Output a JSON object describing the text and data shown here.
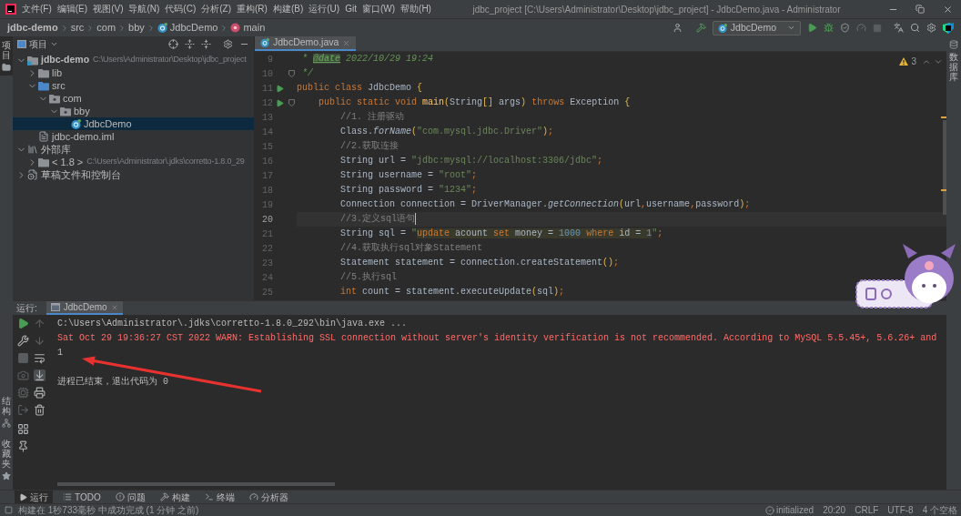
{
  "window": {
    "title": "jdbc_project [C:\\Users\\Administrator\\Desktop\\jdbc_project] - JdbcDemo.java - Administrator"
  },
  "menu": [
    "文件(F)",
    "编辑(E)",
    "视图(V)",
    "导航(N)",
    "代码(C)",
    "分析(Z)",
    "重构(R)",
    "构建(B)",
    "运行(U)",
    "Git",
    "窗口(W)",
    "帮助(H)"
  ],
  "breadcrumb": [
    {
      "label": "jdbc-demo",
      "kind": "project"
    },
    {
      "label": "src",
      "kind": "folder"
    },
    {
      "label": "com",
      "kind": "folder"
    },
    {
      "label": "bby",
      "kind": "folder"
    },
    {
      "label": "JdbcDemo",
      "kind": "class"
    },
    {
      "label": "main",
      "kind": "method"
    }
  ],
  "toolbar": {
    "run_config": "JdbcDemo"
  },
  "left_strip": {
    "top": [
      {
        "label": "项目",
        "kind": "project",
        "selected": true
      }
    ],
    "bottom": [
      {
        "label": "结构",
        "kind": "structure",
        "selected": false
      },
      {
        "label": "收藏夹",
        "kind": "favorites",
        "selected": false
      }
    ]
  },
  "right_strip": [
    {
      "label": "数据库",
      "kind": "database",
      "selected": false
    }
  ],
  "project_panel": {
    "title": "项目",
    "tree": [
      {
        "label": "jdbc-demo",
        "kind": "module",
        "hint": "C:\\Users\\Administrator\\Desktop\\jdbc_project",
        "expanded": true,
        "selected": false,
        "children": [
          {
            "label": "lib",
            "kind": "folder",
            "expanded": false,
            "selected": false
          },
          {
            "label": "src",
            "kind": "source",
            "expanded": true,
            "selected": false,
            "children": [
              {
                "label": "com",
                "kind": "package",
                "expanded": true,
                "selected": false,
                "children": [
                  {
                    "label": "bby",
                    "kind": "package",
                    "expanded": true,
                    "selected": false,
                    "children": [
                      {
                        "label": "JdbcDemo",
                        "kind": "class",
                        "selected": true
                      }
                    ]
                  }
                ]
              }
            ]
          },
          {
            "label": "jdbc-demo.iml",
            "kind": "file",
            "selected": false
          }
        ]
      },
      {
        "label": "外部库",
        "kind": "library",
        "expanded": true,
        "selected": false,
        "children": [
          {
            "label": "< 1.8 >",
            "kind": "sdk",
            "hint": "C:\\Users\\Administrator\\.jdks\\corretto-1.8.0_29",
            "expanded": false,
            "selected": false
          }
        ]
      },
      {
        "label": "草稿文件和控制台",
        "kind": "scratch",
        "expanded": false,
        "selected": false
      }
    ]
  },
  "editor": {
    "tabs": [
      {
        "label": "JdbcDemo.java",
        "selected": true
      }
    ],
    "warning_count": "3",
    "lines": [
      {
        "number": "9",
        "current": false,
        "tokens": [
          {
            "kind": "doc",
            "text": " * "
          },
          {
            "kind": "doctag",
            "text": "@date"
          },
          {
            "kind": "doc",
            "text": " 2022/10/29 19:24"
          }
        ]
      },
      {
        "number": "10",
        "current": false,
        "markers": [
          {
            "kind": "fold"
          }
        ],
        "tokens": [
          {
            "kind": "doc",
            "text": " */"
          }
        ]
      },
      {
        "number": "11",
        "current": false,
        "markers": [
          {
            "kind": "run"
          }
        ],
        "tokens": [
          {
            "kind": "keyword",
            "text": "public class "
          },
          {
            "kind": "plain",
            "text": "JdbcDemo "
          },
          {
            "kind": "brace",
            "text": "{"
          }
        ]
      },
      {
        "number": "12",
        "current": false,
        "markers": [
          {
            "kind": "run"
          },
          {
            "kind": "fold"
          }
        ],
        "tokens": [
          {
            "kind": "keyword",
            "text": "    public static void "
          },
          {
            "kind": "decl",
            "text": "main"
          },
          {
            "kind": "brace",
            "text": "("
          },
          {
            "kind": "plain",
            "text": "String"
          },
          {
            "kind": "brace",
            "text": "[]"
          },
          {
            "kind": "plain",
            "text": " args"
          },
          {
            "kind": "brace",
            "text": ")"
          },
          {
            "kind": "keyword",
            "text": " throws "
          },
          {
            "kind": "plain",
            "text": "Exception "
          },
          {
            "kind": "brace",
            "text": "{"
          }
        ]
      },
      {
        "number": "13",
        "current": false,
        "tokens": [
          {
            "kind": "comment",
            "text": "        //1. 注册驱动"
          }
        ]
      },
      {
        "number": "14",
        "current": false,
        "tokens": [
          {
            "kind": "plain",
            "text": "        Class."
          },
          {
            "kind": "method",
            "text": "forName"
          },
          {
            "kind": "brace",
            "text": "("
          },
          {
            "kind": "string",
            "text": "\"com.mysql.jdbc.Driver\""
          },
          {
            "kind": "brace",
            "text": ")"
          },
          {
            "kind": "keyword",
            "text": ";"
          }
        ]
      },
      {
        "number": "15",
        "current": false,
        "tokens": [
          {
            "kind": "comment",
            "text": "        //2.获取连接"
          }
        ]
      },
      {
        "number": "16",
        "current": false,
        "tokens": [
          {
            "kind": "plain",
            "text": "        String url = "
          },
          {
            "kind": "string",
            "text": "\"jdbc:mysql://localhost:3306/jdbc\""
          },
          {
            "kind": "keyword",
            "text": ";"
          }
        ]
      },
      {
        "number": "17",
        "current": false,
        "tokens": [
          {
            "kind": "plain",
            "text": "        String username = "
          },
          {
            "kind": "string",
            "text": "\"root\""
          },
          {
            "kind": "keyword",
            "text": ";"
          }
        ]
      },
      {
        "number": "18",
        "current": false,
        "tokens": [
          {
            "kind": "plain",
            "text": "        String password = "
          },
          {
            "kind": "string",
            "text": "\"1234\""
          },
          {
            "kind": "keyword",
            "text": ";"
          }
        ]
      },
      {
        "number": "19",
        "current": false,
        "tokens": [
          {
            "kind": "plain",
            "text": "        Connection connection = DriverManager."
          },
          {
            "kind": "method",
            "text": "getConnection"
          },
          {
            "kind": "brace",
            "text": "("
          },
          {
            "kind": "plain",
            "text": "url"
          },
          {
            "kind": "keyword",
            "text": ","
          },
          {
            "kind": "plain",
            "text": "username"
          },
          {
            "kind": "keyword",
            "text": ","
          },
          {
            "kind": "plain",
            "text": "password"
          },
          {
            "kind": "brace",
            "text": ")"
          },
          {
            "kind": "keyword",
            "text": ";"
          }
        ]
      },
      {
        "number": "20",
        "current": true,
        "tokens": [
          {
            "kind": "comment",
            "text": "        //3.定义sql语句"
          }
        ]
      },
      {
        "number": "21",
        "current": false,
        "tokens": [
          {
            "kind": "plain",
            "text": "        String sql = "
          },
          {
            "kind": "string",
            "text": "\""
          },
          {
            "kind": "sql_keyword",
            "text": "update"
          },
          {
            "kind": "sql_plain",
            "text": " acount "
          },
          {
            "kind": "sql_keyword",
            "text": "set"
          },
          {
            "kind": "sql_plain",
            "text": " money = "
          },
          {
            "kind": "sql_number",
            "text": "1000"
          },
          {
            "kind": "sql_keyword",
            "text": " where"
          },
          {
            "kind": "sql_plain",
            "text": " id = "
          },
          {
            "kind": "sql_number",
            "text": "1"
          },
          {
            "kind": "string",
            "text": "\""
          },
          {
            "kind": "keyword",
            "text": ";"
          }
        ]
      },
      {
        "number": "22",
        "current": false,
        "tokens": [
          {
            "kind": "comment",
            "text": "        //4.获取执行sql对象Statement"
          }
        ]
      },
      {
        "number": "23",
        "current": false,
        "tokens": [
          {
            "kind": "plain",
            "text": "        Statement statement = connection.createStatement"
          },
          {
            "kind": "brace",
            "text": "()"
          },
          {
            "kind": "keyword",
            "text": ";"
          }
        ]
      },
      {
        "number": "24",
        "current": false,
        "tokens": [
          {
            "kind": "comment",
            "text": "        //5.执行sql"
          }
        ]
      },
      {
        "number": "25",
        "current": false,
        "tokens": [
          {
            "kind": "keyword",
            "text": "        int "
          },
          {
            "kind": "plain",
            "text": "count = statement.executeUpdate"
          },
          {
            "kind": "brace",
            "text": "("
          },
          {
            "kind": "plain",
            "text": "sql"
          },
          {
            "kind": "brace",
            "text": ")"
          },
          {
            "kind": "keyword",
            "text": ";"
          }
        ]
      }
    ]
  },
  "run_panel": {
    "label": "运行:",
    "tabs": [
      {
        "label": "JdbcDemo",
        "selected": true
      }
    ],
    "console": [
      {
        "kind": "command",
        "text": "C:\\Users\\Administrator\\.jdks\\corretto-1.8.0_292\\bin\\java.exe ..."
      },
      {
        "kind": "error",
        "text": "Sat Oct 29 19:36:27 CST 2022 WARN: Establishing SSL connection without server's identity verification is not recommended. According to MySQL 5.5.45+, 5.6.26+ and"
      },
      {
        "kind": "output",
        "text": "1"
      },
      {
        "kind": "exit",
        "text": "进程已结束，退出代码为 0"
      }
    ]
  },
  "tool_tabs": [
    {
      "label": "运行",
      "kind": "run",
      "selected": true
    },
    {
      "label": "TODO",
      "kind": "todo",
      "selected": false
    },
    {
      "label": "问题",
      "kind": "problems",
      "selected": false
    },
    {
      "label": "构建",
      "kind": "build",
      "selected": false
    },
    {
      "label": "终端",
      "kind": "terminal",
      "selected": false
    },
    {
      "label": "分析器",
      "kind": "profiler",
      "selected": false
    }
  ],
  "status_bar": {
    "message": "构建在 1秒733毫秒 中成功完成 (1 分钟 之前)",
    "items": [
      {
        "kind": "status",
        "text": "initialized"
      },
      {
        "kind": "plain",
        "text": "20:20"
      },
      {
        "kind": "plain",
        "text": "CRLF"
      },
      {
        "kind": "plain",
        "text": "UTF-8"
      },
      {
        "kind": "plain",
        "text": "4 个空格"
      }
    ]
  }
}
